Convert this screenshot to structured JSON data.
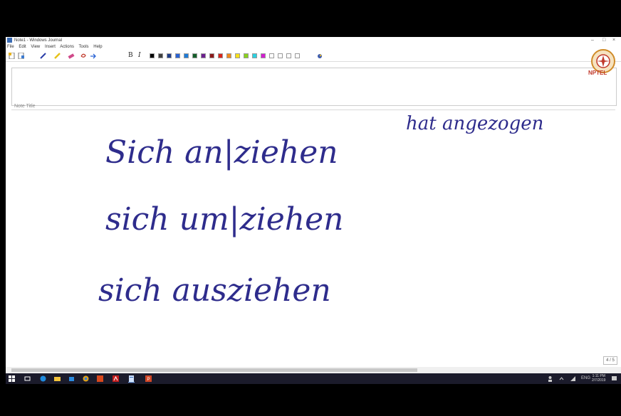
{
  "window": {
    "title": "Note1 - Windows Journal",
    "minimize_glyph": "–",
    "restore_glyph": "□",
    "close_glyph": "×"
  },
  "menu": [
    "File",
    "Edit",
    "View",
    "Insert",
    "Actions",
    "Tools",
    "Help"
  ],
  "toolbar": {
    "bold": "B",
    "italic": "I",
    "colors": [
      "#000000",
      "#404040",
      "#1f3c88",
      "#2a63d4",
      "#1e7bd8",
      "#145f2a",
      "#6b1f8f",
      "#8b1a1a",
      "#d9241c",
      "#f08a1d",
      "#f7e11a",
      "#8ad21e",
      "#2bd0e0",
      "#d21ed0",
      "#ffffff",
      "#ffffff",
      "#ffffff",
      "#ffffff"
    ]
  },
  "note": {
    "title_placeholder": "Note Title"
  },
  "handwriting": {
    "line1": "Sich an|ziehen",
    "line1_side": "hat angezogen",
    "line2": "sich um|ziehen",
    "line3": "sich ausziehen"
  },
  "page_indicator": "4 / 5",
  "logo_label": "NPTEL",
  "taskbar": {
    "time": "1:11 PM",
    "date": "2/7/2019",
    "lang": "ENG"
  }
}
